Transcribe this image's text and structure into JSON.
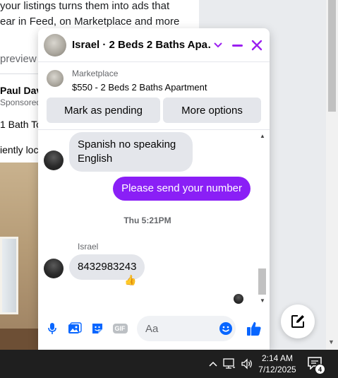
{
  "background": {
    "line1": "your listings turns them into ads that",
    "line2": "ear in Feed, on Marketplace and more",
    "line3": "preview c",
    "advertiser": "Paul Dav",
    "sponsored": "Sponsored",
    "listing_title": "1 Bath To",
    "listing_desc": "iently loc"
  },
  "chat": {
    "title": "Israel · 2 Beds 2 Baths Apa…",
    "icons": {
      "chevron": "chevron-down-icon",
      "minimize": "minimize-icon",
      "close": "close-icon"
    },
    "listing": {
      "label": "Marketplace",
      "title": "$550 - 2 Beds 2 Baths Apartment",
      "mark_pending": "Mark as pending",
      "more_options": "More options"
    },
    "messages": {
      "m1": "Spanish no speaking English",
      "m2": "Please send your number",
      "timestamp": "Thu 5:21PM",
      "sender": "Israel",
      "m3": "8432983243",
      "reaction": "👍"
    },
    "composer": {
      "placeholder": "Aa"
    }
  },
  "taskbar": {
    "time": "2:14 AM",
    "date": "7/12/2025",
    "notification_count": "4"
  },
  "colors": {
    "accent": "#8a1ff6",
    "icon_blue": "#0866ff",
    "header_purple": "#9b1ff0"
  }
}
